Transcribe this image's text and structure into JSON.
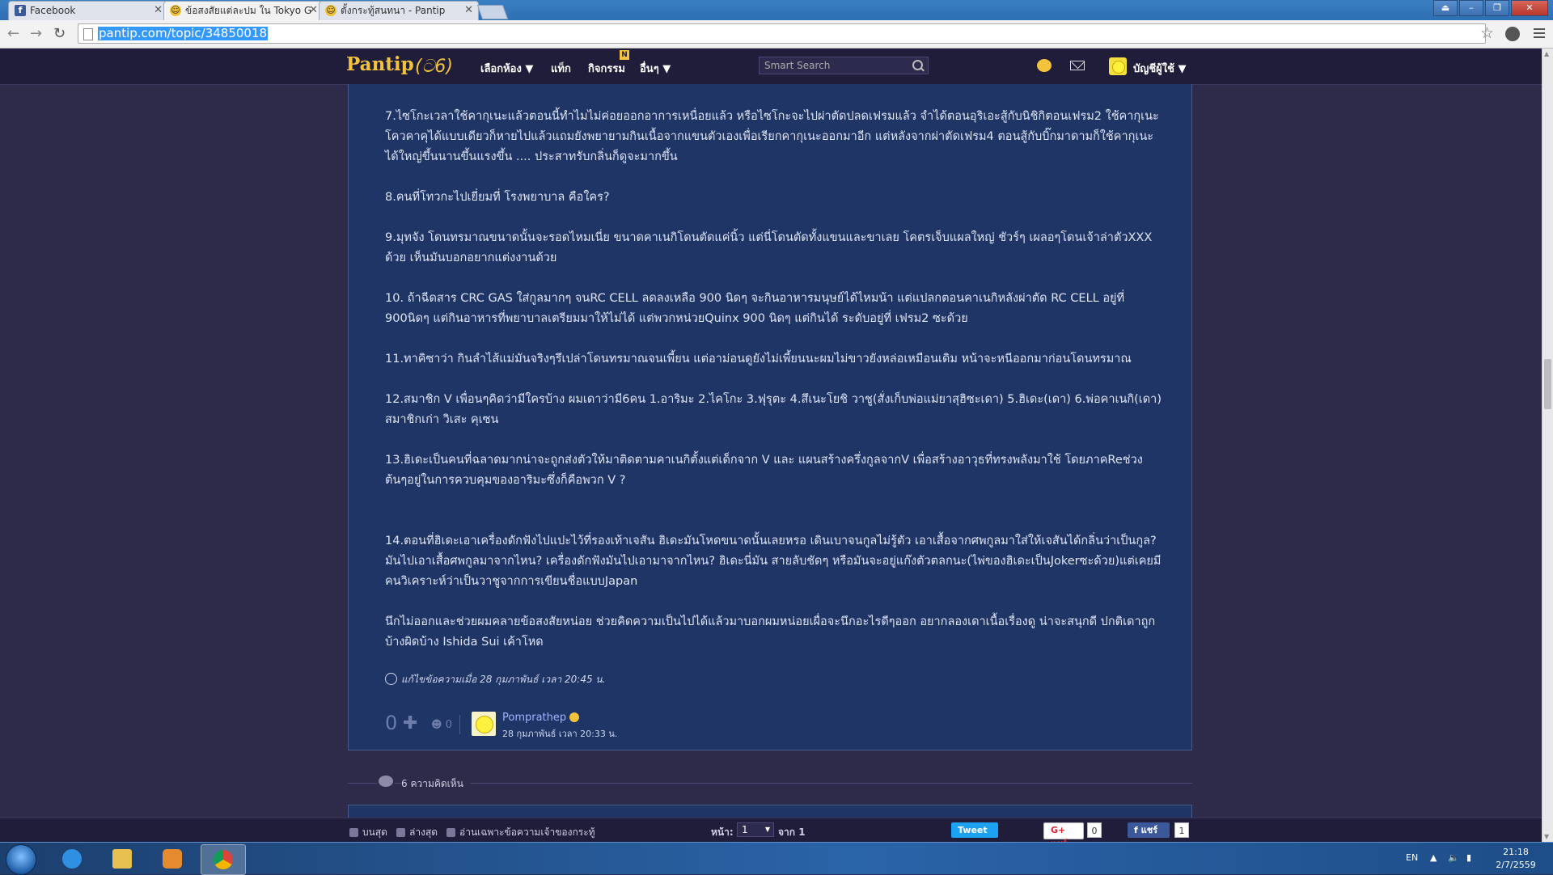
{
  "browser": {
    "tabs": [
      {
        "title": "Facebook",
        "icon": "facebook-icon"
      },
      {
        "title": "ข้อสงสัยแต่ละปม ใน Tokyo G",
        "icon": "pantip-icon"
      },
      {
        "title": "ตั้งกระทู้สนทนา - Pantip",
        "icon": "pantip-icon"
      }
    ],
    "url": "pantip.com/topic/34850018"
  },
  "site": {
    "logo": "Pantip",
    "logo_mark": "(ට6)",
    "nav": [
      "เลือกห้อง ▼",
      "แท็ก",
      "กิจกรรม",
      "อื่นๆ ▼"
    ],
    "activity_badge": "N",
    "search_placeholder": "Smart Search",
    "account_label": "บัญชีผู้ใช้ ▼"
  },
  "post": {
    "paragraphs": [
      "7.ไซโกะเวลาใช้คากุเนะแล้วตอนนี้ทำไมไม่ค่อยออกอาการเหนื่อยแล้ว หรือไซโกะจะไปผ่าตัดปลดเฟรมแล้ว จำได้ตอนอุริเอะสู้กับนิชิกิตอนเฟรม2 ใช้คากุเนะโควคาคุได้แบบเดียวก็หายไปแล้วแถมยังพยายามกินเนื้อจากแขนตัวเองเพื่อเรียกคากุเนะออกมาอีก แต่หลังจากผ่าตัดเฟรม4 ตอนสู้กับบิ๊กมาดามก็ใช้คากุเนะได้ใหญ่ขึ้นนานขึ้นแรงขึ้น .... ประสาทรับกลิ่นก็ดูจะมากขึ้น",
      "8.คนที่โทวกะไปเยี่ยมที่ โรงพยาบาล คือใคร?",
      "9.มุทจัง โดนทรมาณขนาดนั้นจะรอดไหมเนี่ย ขนาดคาเนกิโดนตัดแค่นิ้ว แต่นี่โดนตัดทั้งแขนและขาเลย โคตรเจ็บแผลใหญ่ ชัวร์ๆ เผลอๆโดนเจ้าล่าตัวXXX ด้วย เห็นมันบอกอยากแต่งงานด้วย",
      "10. ถ้าฉีดสาร CRC GAS ใส่กูลมากๆ จนRC CELL ลดลงเหลือ 900 นิดๆ จะกินอาหารมนุษย์ได้ไหมน้า แต่แปลกตอนคาเนกิหลังผ่าตัด RC CELL อยู่ที่ 900นิดๆ แต่กินอาหารที่พยาบาลเตรียมมาให้ไม่ได้ แต่พวกหน่วยQuinx 900 นิดๆ แต่กินได้ ระดับอยู่ที่ เฟรม2 ซะด้วย",
      "11.ทาคิซาว่า กินลำไส้แม่มันจริงๆรึเปล่าโดนทรมาณจนเพี้ยน แต่อาม่อนดูยังไม่เพี้ยนนะผมไม่ขาวยังหล่อเหมือนเดิม หน้าจะหนีออกมาก่อนโดนทรมาณ",
      "12.สมาชิก V เพื่อนๆคิดว่ามีใครบ้าง ผมเดาว่ามี6คน 1.อาริมะ 2.ไคโกะ 3.ฟุรุตะ 4.สึเนะโยชิ วาชู(สั่งเก็บพ่อแม่ยาสุฮิซะเดา) 5.ฮิเดะ(เดา) 6.พ่อคาเนกิ(เดา) สมาชิกเก่า วิเสะ คุเซน",
      "13.ฮิเดะเป็นคนที่ฉลาดมากน่าจะถูกส่งตัวให้มาติดตามคาเนกิตั้งแต่เด็กจาก V และ แผนสร้างครึ่งกูลจากV เพื่อสร้างอาวุธที่ทรงพลังมาใช้ โดยภาคReช่วงต้นๆอยู่ในการควบคุมของอาริมะซึ่งก็คือพวก V ?",
      "14.ตอนที่ฮิเดะเอาเครื่องดักฟังไปแปะไว้ที่รองเท้าเจสัน ฮิเดะมันโหดขนาดนั้นเลยหรอ เดินเบาจนกูลไม่รู้ตัว เอาเสื้อจากศพกูลมาใส่ให้เจสันได้กลิ่นว่าเป็นกูล? มันไปเอาเสื้อศพกูลมาจากไหน? เครื่องดักฟังมันไปเอามาจากไหน? ฮิเดะนี่มัน สายลับชัดๆ หรือมันจะอยู่แก๊งตัวตลกนะ(ไพ่ของฮิเดะเป็นJokerซะด้วย)แต่เคยมีคนวิเคราะห์ว่าเป็นวาชูจากการเขียนชื่อแบบJapan",
      "นึกไม่ออกและช่วยผมคลายข้อสงสัยหน่อย ช่วยคิดความเป็นไปได้แล้วมาบอกผมหน่อยเผื่อจะนึกอะไรดีๆออก อยากลองเดาเนื้อเรื่องดู น่าจะสนุกดี ปกติเดาถูกบ้างผิดบ้าง Ishida Sui เค้าโหด"
    ],
    "edited_note": "แก้ไขข้อความเมื่อ 28 กุมภาพันธ์ เวลา 20:45 น.",
    "vote_count": "0",
    "emotion_count": "0",
    "author": "Pomprathep",
    "posted_time": "28 กุมภาพันธ์ เวลา 20:33 น."
  },
  "comments": {
    "label": "6 ความคิดเห็น"
  },
  "bottombar": {
    "top_label": "บนสุด",
    "bottom_label": "ล่างสุด",
    "owner_only_label": "อ่านเฉพาะข้อความเจ้าของกระทู้",
    "page_label": "หน้า:",
    "page_value": "1",
    "of_label": "จาก 1",
    "tweet_label": "Tweet",
    "gplus_label": "G+ แชร์",
    "gplus_count": "0",
    "fb_label": "แชร์",
    "fb_count": "1"
  },
  "taskbar": {
    "lang": "EN",
    "time": "21:18",
    "date": "2/7/2559"
  }
}
